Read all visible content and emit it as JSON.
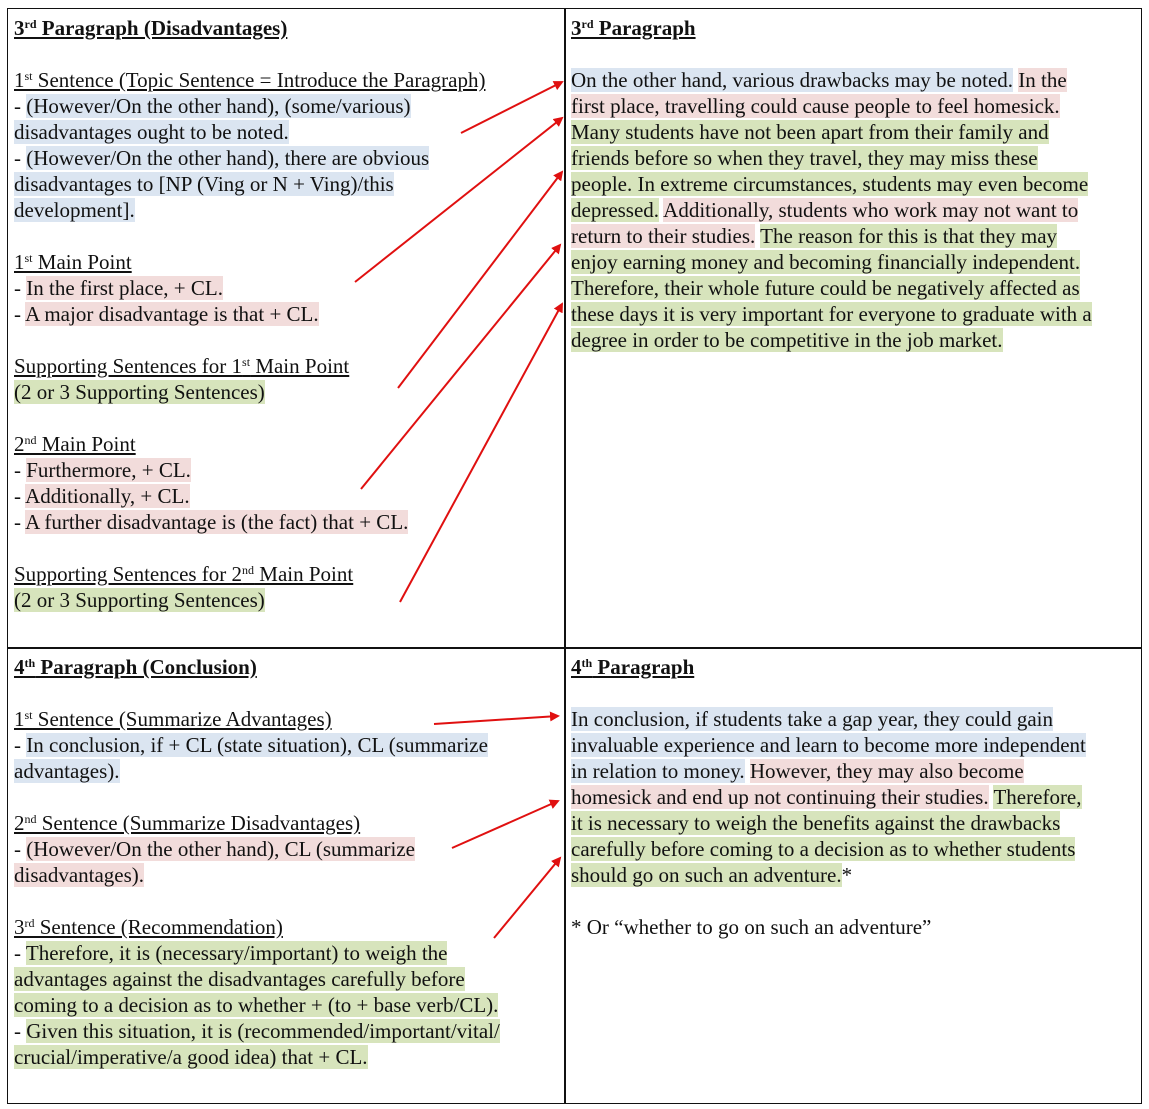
{
  "colors": {
    "topic_highlight": "#dbe5f1",
    "main_point_highlight": "#f2dcdb",
    "support_highlight": "#d7e4bc",
    "arrow": "#e01010",
    "border": "#111111"
  },
  "top_left": {
    "heading": {
      "num": "3",
      "sup": "rd",
      "text": " Paragraph (Disadvantages)"
    },
    "s1_label": {
      "num": "1",
      "sup": "st",
      "text": " Sentence (Topic Sentence = Introduce the Paragraph)"
    },
    "s1_lines": [
      "(However/On the other hand), (some/various)",
      "disadvantages ought to be noted.",
      "(However/On the other hand), there are obvious",
      "disadvantages to [NP (Ving or N + Ving)/this",
      "development]."
    ],
    "mp1_label": {
      "num": "1",
      "sup": "st",
      "text": " Main Point"
    },
    "mp1_lines": [
      "In the first place, + CL.",
      "A major disadvantage is that + CL."
    ],
    "ss1_label": {
      "pre": "Supporting Sentences for 1",
      "sup": "st",
      "post": " Main Point"
    },
    "ss1_text": "(2 or 3 Supporting Sentences)",
    "mp2_label": {
      "num": "2",
      "sup": "nd",
      "text": " Main Point"
    },
    "mp2_lines": [
      "Furthermore, + CL.",
      "Additionally, + CL.",
      "A further disadvantage is (the fact) that + CL."
    ],
    "ss2_label": {
      "pre": "Supporting Sentences for 2",
      "sup": "nd",
      "post": " Main Point"
    },
    "ss2_text": "(2 or 3 Supporting Sentences)",
    "dash": "- "
  },
  "top_right": {
    "heading": {
      "num": "3",
      "sup": "rd",
      "text": " Paragraph"
    },
    "lines": [
      [
        {
          "t": "On the other hand, various drawbacks may be noted.",
          "c": "b"
        },
        {
          "t": " ",
          "c": ""
        },
        {
          "t": "In the",
          "c": "p"
        }
      ],
      [
        {
          "t": "first place, travelling could cause people to feel homesick.",
          "c": "p"
        }
      ],
      [
        {
          "t": "Many students have not been apart from their family and",
          "c": "g"
        }
      ],
      [
        {
          "t": "friends before so when they travel, they may miss these",
          "c": "g"
        }
      ],
      [
        {
          "t": "people. In extreme circumstances, students may even become",
          "c": "g"
        }
      ],
      [
        {
          "t": "depressed.",
          "c": "g"
        },
        {
          "t": " ",
          "c": ""
        },
        {
          "t": "Additionally, students who work may not want to",
          "c": "p"
        }
      ],
      [
        {
          "t": "return to their studies.",
          "c": "p"
        },
        {
          "t": " ",
          "c": ""
        },
        {
          "t": "The reason for this is that they may",
          "c": "g"
        }
      ],
      [
        {
          "t": "enjoy earning money and becoming financially independent.",
          "c": "g"
        }
      ],
      [
        {
          "t": "Therefore, their whole future could be negatively affected as",
          "c": "g"
        }
      ],
      [
        {
          "t": "these days it is very important for everyone to graduate with a",
          "c": "g"
        }
      ],
      [
        {
          "t": "degree in order to be competitive in the job market.",
          "c": "g"
        }
      ]
    ]
  },
  "bottom_left": {
    "heading": {
      "num": "4",
      "sup": "th",
      "text": " Paragraph (Conclusion)"
    },
    "s1_label": {
      "num": "1",
      "sup": "st",
      "text": " Sentence (Summarize Advantages)"
    },
    "s1_lines": [
      "In conclusion, if + CL (state situation), CL (summarize",
      "advantages)."
    ],
    "s2_label": {
      "num": "2",
      "sup": "nd",
      "text": " Sentence (Summarize Disadvantages)"
    },
    "s2_lines": [
      "(However/On the other hand), CL (summarize",
      "disadvantages)."
    ],
    "s3_label": {
      "num": "3",
      "sup": "rd",
      "text": " Sentence (Recommendation)"
    },
    "s3_lines": [
      "Therefore, it is (necessary/important) to weigh the",
      "advantages against the disadvantages carefully before",
      "coming to a decision as to whether + (to + base verb/CL).",
      "Given this situation, it is (recommended/important/vital/",
      "crucial/imperative/a good idea) that + CL."
    ],
    "dash": "- "
  },
  "bottom_right": {
    "heading": {
      "num": "4",
      "sup": "th",
      "text": " Paragraph"
    },
    "lines": [
      [
        {
          "t": "In conclusion, if students take a gap year, they could gain",
          "c": "b"
        }
      ],
      [
        {
          "t": "invaluable experience and learn to become more independent",
          "c": "b"
        }
      ],
      [
        {
          "t": "in relation to money.",
          "c": "b"
        },
        {
          "t": " ",
          "c": ""
        },
        {
          "t": "However, they may also become",
          "c": "p"
        }
      ],
      [
        {
          "t": "homesick and end up not continuing their studies.",
          "c": "p"
        },
        {
          "t": " ",
          "c": ""
        },
        {
          "t": "Therefore,",
          "c": "g"
        }
      ],
      [
        {
          "t": "it is necessary to weigh the benefits against the drawbacks",
          "c": "g"
        }
      ],
      [
        {
          "t": "carefully before coming to a decision as to whether students",
          "c": "g"
        }
      ],
      [
        {
          "t": "should go on such an adventure.",
          "c": "g"
        },
        {
          "t": "*",
          "c": ""
        }
      ]
    ],
    "footnote": "* Or “whether to go on such an adventure”"
  }
}
